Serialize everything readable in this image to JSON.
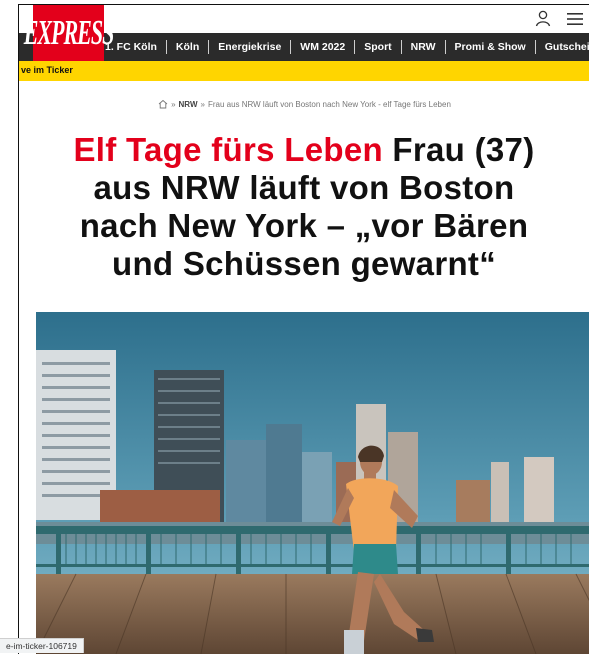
{
  "header": {
    "logo_text": "EXPRESS",
    "brand_color": "#e3001b"
  },
  "nav": {
    "items": [
      "1. FC Köln",
      "Köln",
      "Energiekrise",
      "WM 2022",
      "Sport",
      "NRW",
      "Promi & Show",
      "Gutscheine"
    ]
  },
  "ticker": {
    "label": "ve im Ticker",
    "color": "#ffd500"
  },
  "breadcrumb": {
    "section": "NRW",
    "separator": "»",
    "current": "Frau aus NRW läuft von Boston nach New York - elf Tage fürs Leben"
  },
  "article": {
    "kicker": "Elf Tage fürs Leben",
    "title": "Frau (37) aus NRW läuft von Boston nach New York – „vor Bären und Schüssen gewarnt“"
  },
  "status": {
    "url": "e-im-ticker-106719"
  }
}
